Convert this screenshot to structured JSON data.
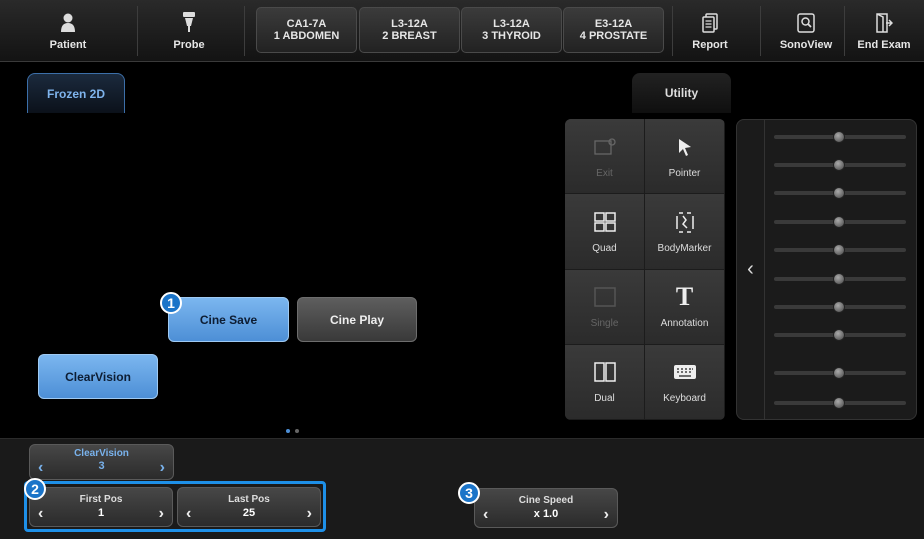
{
  "topbar": {
    "patient": "Patient",
    "probe": "Probe",
    "probes": [
      {
        "line1": "CA1-7A",
        "line2": "1 ABDOMEN"
      },
      {
        "line1": "L3-12A",
        "line2": "2 BREAST"
      },
      {
        "line1": "L3-12A",
        "line2": "3 THYROID"
      },
      {
        "line1": "E3-12A",
        "line2": "4 PROSTATE"
      }
    ],
    "report": "Report",
    "sonoview": "SonoView",
    "end_exam": "End Exam"
  },
  "tabs": {
    "frozen": "Frozen 2D",
    "utility": "Utility"
  },
  "buttons": {
    "cine_save": "Cine Save",
    "cine_play": "Cine Play",
    "clearvision": "ClearVision"
  },
  "callouts": [
    "1",
    "2",
    "3"
  ],
  "utility_grid": [
    {
      "label": "Exit",
      "icon": "exit-icon",
      "enabled": false
    },
    {
      "label": "Pointer",
      "icon": "pointer-icon",
      "enabled": true
    },
    {
      "label": "Quad",
      "icon": "quad-icon",
      "enabled": true
    },
    {
      "label": "BodyMarker",
      "icon": "bodymarker-icon",
      "enabled": true
    },
    {
      "label": "Single",
      "icon": "single-icon",
      "enabled": false
    },
    {
      "label": "Annotation",
      "icon": "annotation-icon",
      "enabled": true
    },
    {
      "label": "Dual",
      "icon": "dual-icon",
      "enabled": true
    },
    {
      "label": "Keyboard",
      "icon": "keyboard-icon",
      "enabled": true
    }
  ],
  "bottom": {
    "clearvision": {
      "label": "ClearVision",
      "value": "3"
    },
    "first_pos": {
      "label": "First Pos",
      "value": "1"
    },
    "last_pos": {
      "label": "Last Pos",
      "value": "25"
    },
    "cine_speed": {
      "label": "Cine Speed",
      "value": "x 1.0"
    }
  },
  "colors": {
    "accent": "#4d8fd6",
    "callout": "#1b74c8",
    "highlight": "#1e90e8"
  }
}
